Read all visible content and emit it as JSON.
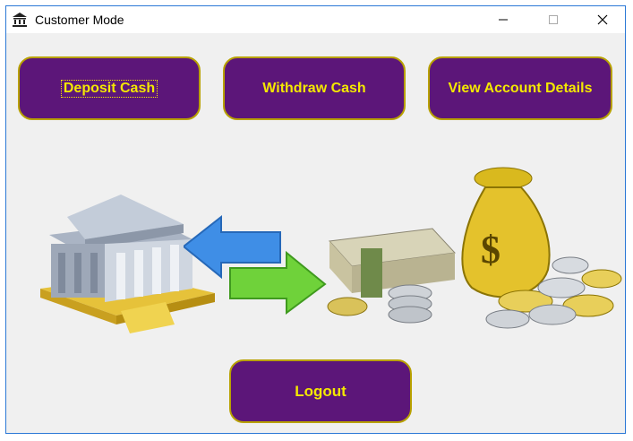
{
  "window": {
    "title": "Customer Mode",
    "icon": "bank-icon"
  },
  "title_controls": {
    "minimize": "minimize-icon",
    "maximize": "maximize-icon",
    "close": "close-icon"
  },
  "actions": {
    "deposit_label": "Deposit Cash",
    "withdraw_label": "Withdraw Cash",
    "details_label": "View Account Details",
    "logout_label": "Logout"
  },
  "illustrations": [
    "bank-building-icon",
    "transfer-arrows-icon",
    "cash-stack-icon",
    "money-bag-icon"
  ],
  "colors": {
    "button_bg": "#5c1679",
    "button_text": "#f4e800",
    "button_border": "#b8a100",
    "window_bg": "#f0f0f0",
    "window_border": "#2b78d6"
  }
}
